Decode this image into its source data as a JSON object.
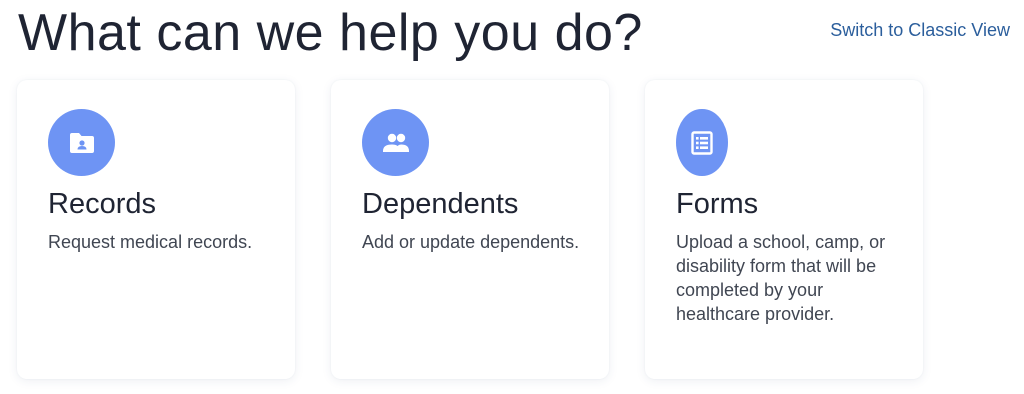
{
  "header": {
    "title": "What can we help you do?",
    "switch_link": "Switch to Classic View"
  },
  "cards": [
    {
      "title": "Records",
      "description": "Request medical records.",
      "icon": "folder-person-icon"
    },
    {
      "title": "Dependents",
      "description": "Add or update dependents.",
      "icon": "people-icon"
    },
    {
      "title": "Forms",
      "description": "Upload a school, camp, or disability form that will be completed by your healthcare provider.",
      "icon": "form-list-icon"
    }
  ],
  "colors": {
    "accent": "#6e94f4",
    "link": "#2b5e9c",
    "text": "#1f2433"
  }
}
